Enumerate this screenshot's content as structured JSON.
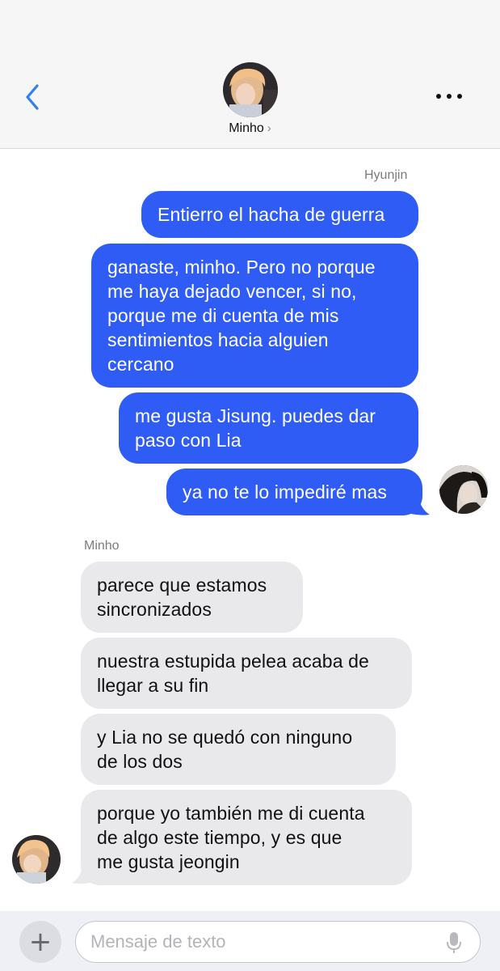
{
  "header": {
    "contact_name": "Minho",
    "chevron": "›",
    "back_icon": "chevron-left-icon",
    "more_icon": "ellipsis-icon",
    "accent_color": "#2f7ff0"
  },
  "thread": {
    "outgoing_sender": "Hyunjin",
    "incoming_sender": "Minho",
    "outgoing_messages": [
      "Entierro el hacha de guerra",
      "ganaste, minho. Pero no porque\nme haya dejado vencer, si no,\nporque me di cuenta de mis\nsentimientos hacia alguien\ncercano",
      "me gusta Jisung. puedes dar\npaso con Lia",
      "ya no te lo impediré mas"
    ],
    "incoming_messages": [
      "parece que estamos\nsincronizados",
      "nuestra estupida pelea acaba de\nllegar a su fin",
      "y Lia no se quedó con ninguno\nde los dos",
      "porque yo también me di cuenta\nde algo este tiempo, y es que\nme gusta jeongin"
    ],
    "outgoing_color": "#2f5cf4",
    "incoming_color": "#e9e9eb"
  },
  "composer": {
    "placeholder": "Mensaje de texto",
    "plus_icon": "plus-icon",
    "mic_icon": "microphone-icon"
  }
}
